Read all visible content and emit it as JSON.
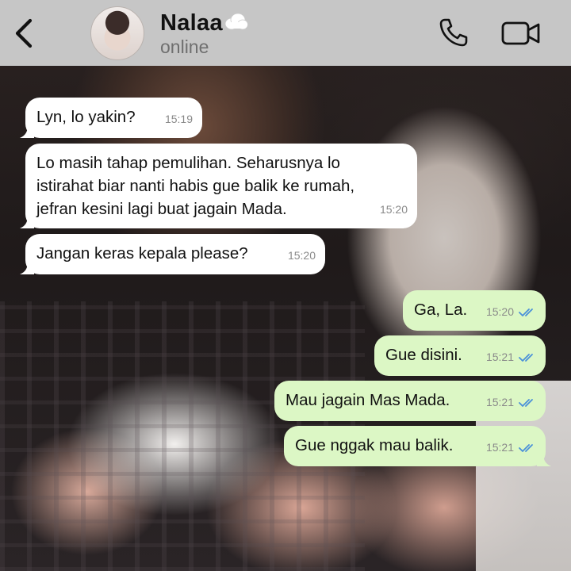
{
  "header": {
    "contact_name": "Nalaa",
    "status": "online",
    "icons": {
      "back": "chevron-left-icon",
      "name_emoji": "cloud-icon",
      "call": "phone-icon",
      "video": "video-camera-icon"
    }
  },
  "colors": {
    "header_bg": "#c6c6c6",
    "incoming_bubble": "#ffffff",
    "outgoing_bubble": "#dcf7c5",
    "read_ticks": "#4a90d9",
    "timestamp": "#8a8a8a"
  },
  "messages": [
    {
      "direction": "in",
      "text": "Lyn, lo yakin?",
      "time": "15:19"
    },
    {
      "direction": "in",
      "text": "Lo masih tahap pemulihan. Seharusnya lo\nistirahat biar nanti habis gue balik ke rumah,\njefran kesini lagi buat jagain Mada.",
      "time": "15:20"
    },
    {
      "direction": "in",
      "text": "Jangan keras kepala please?",
      "time": "15:20"
    },
    {
      "direction": "out",
      "text": "Ga, La.",
      "time": "15:20",
      "status": "read"
    },
    {
      "direction": "out",
      "text": "Gue disini.",
      "time": "15:21",
      "status": "read"
    },
    {
      "direction": "out",
      "text": "Mau jagain Mas Mada.",
      "time": "15:21",
      "status": "read"
    },
    {
      "direction": "out",
      "text": "Gue nggak mau balik.",
      "time": "15:21",
      "status": "read"
    }
  ]
}
